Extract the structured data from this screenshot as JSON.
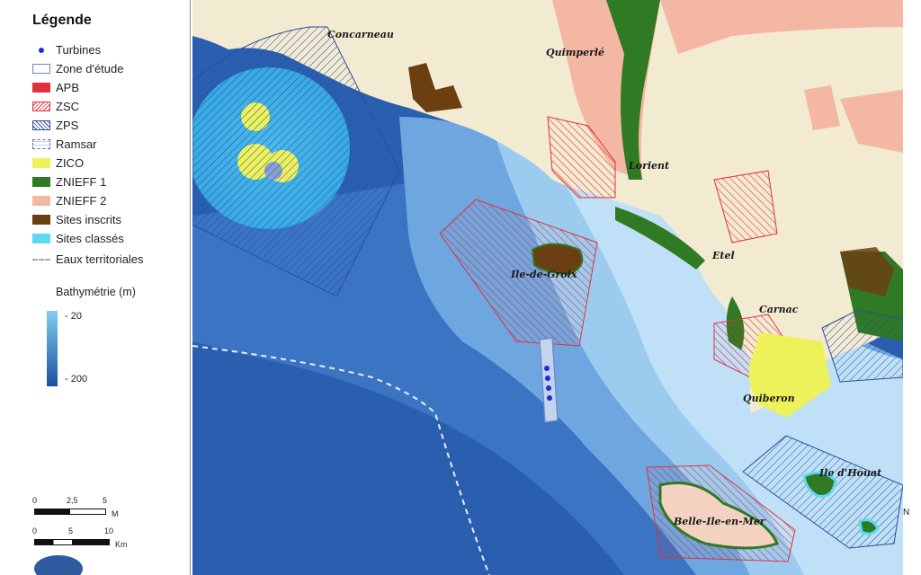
{
  "legend": {
    "title": "Légende",
    "items": [
      {
        "label": "Turbines",
        "symbol": "dot",
        "color": "#1a2fd6"
      },
      {
        "label": "Zone d'étude",
        "symbol": "outline",
        "color": "#6b86c9"
      },
      {
        "label": "APB",
        "symbol": "fill",
        "color": "#e0323c"
      },
      {
        "label": "ZSC",
        "symbol": "hatch",
        "color": "#e0323c"
      },
      {
        "label": "ZPS",
        "symbol": "hatch",
        "color": "#2a4f9e"
      },
      {
        "label": "Ramsar",
        "symbol": "dash",
        "color": "#4c6bb5"
      },
      {
        "label": "ZICO",
        "symbol": "fill",
        "color": "#eef25a"
      },
      {
        "label": "ZNIEFF 1",
        "symbol": "fill",
        "color": "#2f7a22"
      },
      {
        "label": "ZNIEFF 2",
        "symbol": "fill",
        "color": "#f4b7a3"
      },
      {
        "label": "Sites inscrits",
        "symbol": "fill",
        "color": "#6b3f12"
      },
      {
        "label": "Sites classés",
        "symbol": "fill",
        "color": "#5fd8f2"
      },
      {
        "label": "Eaux territoriales",
        "symbol": "dashline",
        "color": "#aaaaaa"
      }
    ],
    "bathymetry": {
      "title": "Bathymétrie (m)",
      "min_label": "- 20",
      "max_label": "- 200"
    },
    "scale_miles": {
      "ticks": [
        "0",
        "2,5",
        "5"
      ],
      "unit": "M"
    },
    "scale_km": {
      "ticks": [
        "0",
        "5",
        "10"
      ],
      "unit": "Km"
    }
  },
  "map": {
    "places": [
      "Concarneau",
      "Quimperlé",
      "Lorient",
      "Ile-de-Groix",
      "Etel",
      "Carnac",
      "Quiberon",
      "Ile d'Houat",
      "Belle-Ile-en-Mer"
    ],
    "north_label": "N",
    "colors": {
      "land": "#f3ead2",
      "sea_shallow": "#bfe0f6",
      "sea_deep": "#2a5fb0",
      "zsc": "#e0323c",
      "zps": "#2a4f9e",
      "zico": "#eef25a",
      "znieff1": "#2f7a22",
      "znieff2": "#f4b7a3",
      "sites_inscrits": "#6b3f12",
      "sites_classes": "#5fd8f2"
    }
  }
}
